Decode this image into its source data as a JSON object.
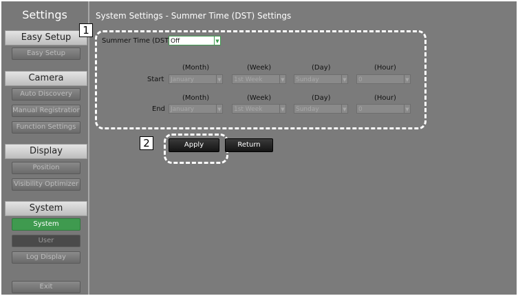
{
  "sidebar": {
    "title": "Settings",
    "sections": [
      {
        "label": "Easy Setup"
      },
      {
        "label": "Camera"
      },
      {
        "label": "Display"
      },
      {
        "label": "System"
      }
    ],
    "buttons": {
      "easy_setup": "Easy Setup",
      "auto_discovery": "Auto Discovery",
      "manual_registration": "Manual Registration",
      "function_settings": "Function Settings",
      "position": "Position",
      "visibility_optimizer": "Visibility Optimizer",
      "system": "System",
      "user": "User",
      "log_display": "Log Display",
      "exit": "Exit"
    }
  },
  "main": {
    "title": "System Settings - Summer Time (DST) Settings",
    "dst_label": "Summer Time (DST)",
    "dst_value": "Off",
    "headers": {
      "month": "(Month)",
      "week": "(Week)",
      "day": "(Day)",
      "hour": "(Hour)"
    },
    "start": {
      "label": "Start",
      "month": "January",
      "week": "1st Week",
      "day": "Sunday",
      "hour": "0"
    },
    "end": {
      "label": "End",
      "month": "January",
      "week": "1st Week",
      "day": "Sunday",
      "hour": "0"
    },
    "apply_label": "Apply",
    "return_label": "Return"
  },
  "callouts": {
    "one": "1",
    "two": "2"
  },
  "colors": {
    "accent_green": "#3f9a4f",
    "panel_gray": "#7b7b7b"
  }
}
